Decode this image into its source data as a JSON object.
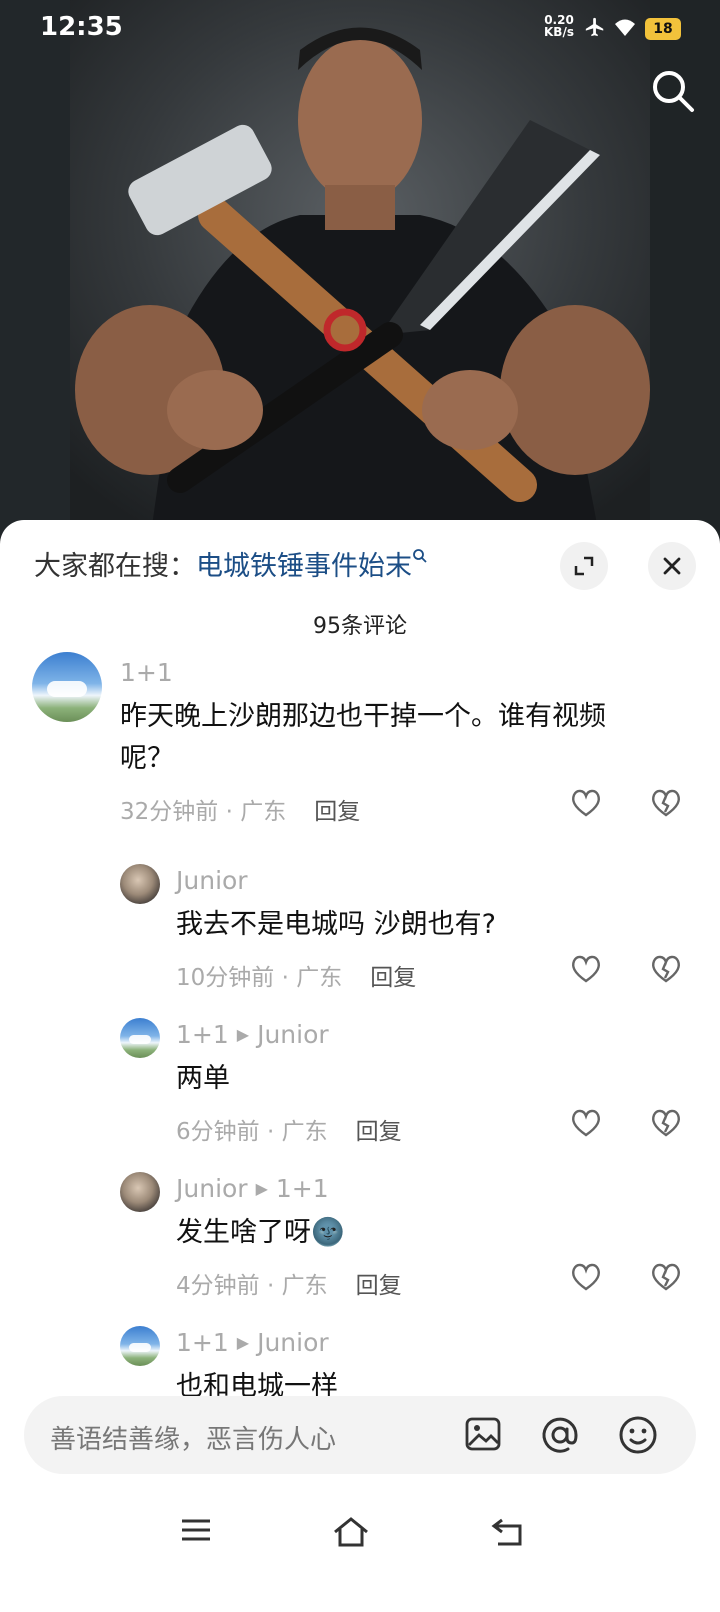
{
  "status": {
    "time": "12:35",
    "net_speed_value": "0.20",
    "net_speed_unit": "KB/s",
    "battery": "18"
  },
  "icons": {
    "search": "search-icon",
    "expand": "expand-icon",
    "close": "close-icon",
    "like": "heart-icon",
    "dislike": "broken-heart-icon",
    "image": "image-icon",
    "mention": "at-icon",
    "emoji": "emoji-icon"
  },
  "sheet": {
    "hot_search_prefix": "大家都在搜：",
    "hot_search_topic": "电城铁锤事件始末",
    "comment_count": "95条评论"
  },
  "comments": [
    {
      "author": "1+1",
      "reply_to": "",
      "text_line1": "昨天晚上沙朗那边也干掉一个。谁有视频",
      "text_line2": "呢？",
      "time": "32分钟前",
      "location": "广东",
      "reply_label": "回复"
    },
    {
      "author": "Junior",
      "reply_to": "",
      "text_line1": "我去不是电城吗 沙朗也有?",
      "time": "10分钟前",
      "location": "广东",
      "reply_label": "回复"
    },
    {
      "author": "1+1",
      "reply_to": "Junior",
      "text_line1": "两单",
      "time": "6分钟前",
      "location": "广东",
      "reply_label": "回复"
    },
    {
      "author": "Junior",
      "reply_to": "1+1",
      "text_line1": "发生啥了呀",
      "emoji": "🌚",
      "time": "4分钟前",
      "location": "广东",
      "reply_label": "回复"
    },
    {
      "author": "1+1",
      "reply_to": "Junior",
      "text_line1": "也和电城一样"
    }
  ],
  "input": {
    "placeholder": "善语结善缘，恶言伤人心"
  }
}
